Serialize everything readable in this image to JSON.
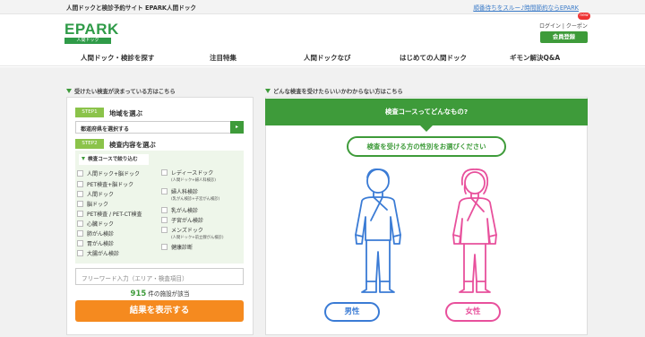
{
  "topbar": {
    "site_tagline": "人間ドックと検診予約サイト EPARK人間ドック",
    "promo_link": "順番待ちをスルー♪時間節約ならEPARK"
  },
  "logo": {
    "word": "EPARK",
    "sub": "人間ドック"
  },
  "header": {
    "login_text": "ログイン | クーポン",
    "new_badge": "new",
    "member_button": "会員登録"
  },
  "nav": {
    "items": [
      "人間ドック・検診を探す",
      "注目特集",
      "人間ドックなび",
      "はじめての人間ドック",
      "ギモン解決Q&A"
    ]
  },
  "left": {
    "heading": "受けたい検査が決まっている方はこちら",
    "step1": {
      "badge": "STEP1",
      "label": "地域を選ぶ"
    },
    "prefecture_select": "都道府県を選択する",
    "step2": {
      "badge": "STEP2",
      "label": "検査内容を選ぶ"
    },
    "narrow_heading": "検査コースで絞り込む",
    "checkboxes_left": [
      {
        "label": "人間ドック+脳ドック"
      },
      {
        "label": "PET検査+脳ドック"
      },
      {
        "label": "人間ドック"
      },
      {
        "label": "脳ドック"
      },
      {
        "label": "PET検査 / PET-CT検査"
      },
      {
        "label": "心臓ドック"
      },
      {
        "label": "肺がん検診"
      },
      {
        "label": "胃がん検診"
      },
      {
        "label": "大腸がん検診"
      }
    ],
    "checkboxes_right": [
      {
        "label": "レディースドック",
        "sub": "(人間ドック+婦人科検診)"
      },
      {
        "label": "婦人科検診",
        "sub": "(乳がん検診+子宮がん検診)"
      },
      {
        "label": "乳がん検診"
      },
      {
        "label": "子宮がん検診"
      },
      {
        "label": "メンズドック",
        "sub": "(人間ドック+前立腺がん検診)"
      },
      {
        "label": "健康診断"
      }
    ],
    "free_word_placeholder": "フリーワード入力（エリア・検査項目）",
    "count_number": "915",
    "count_suffix": "件の施設が該当",
    "result_button": "結果を表示する"
  },
  "right": {
    "heading": "どんな検査を受けたらいいかわからない方はこちら",
    "panel_title": "検査コースってどんなもの?",
    "gender_prompt": "検査を受ける方の性別をお選びください",
    "male_label": "男性",
    "female_label": "女性",
    "colors": {
      "male": "#3a7bd5",
      "female": "#e8509c",
      "accent": "#3e9b3a",
      "orange": "#f58a1f"
    }
  }
}
